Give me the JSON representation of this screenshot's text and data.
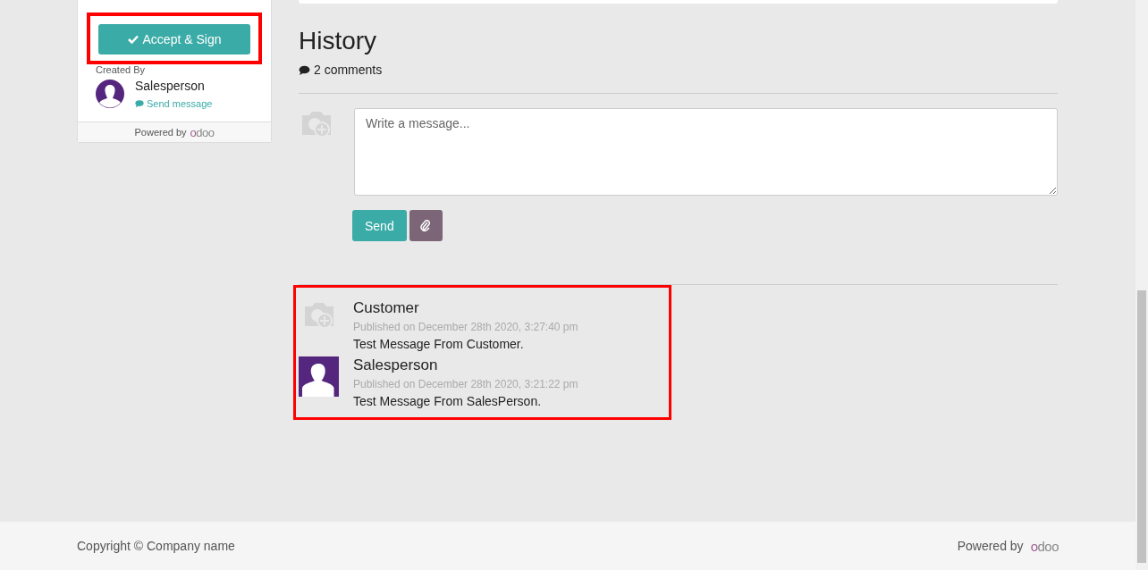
{
  "sidebar": {
    "accept_button": "Accept & Sign",
    "created_by_label": "Created By",
    "salesperson": "Salesperson",
    "send_message": "Send message",
    "powered_by": "Powered by",
    "logo": "odoo"
  },
  "history": {
    "title": "History",
    "comments": "2 comments",
    "composer": {
      "placeholder": "Write a message..."
    },
    "send_button": "Send",
    "messages": [
      {
        "author": "Customer",
        "kind": "placeholder",
        "published": "Published on December 28th 2020, 3:27:40 pm",
        "body": "Test Message From Customer."
      },
      {
        "author": "Salesperson",
        "kind": "person",
        "published": "Published on December 28th 2020, 3:21:22 pm",
        "body": "Test Message From SalesPerson."
      }
    ]
  },
  "footer": {
    "copyright": "Copyright © Company name",
    "powered_by": "Powered by",
    "logo": "odoo"
  }
}
